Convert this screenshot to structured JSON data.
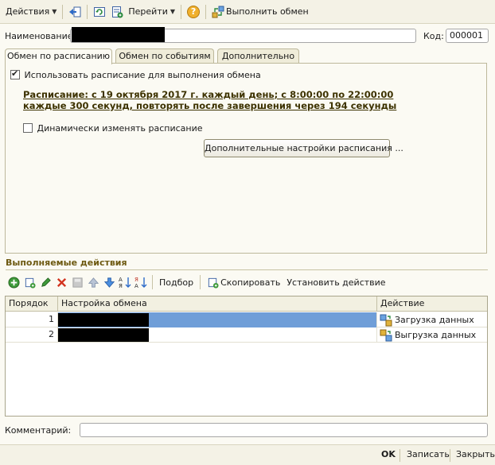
{
  "toolbar": {
    "actions_label": "Действия",
    "goto_label": "Перейти",
    "run_exchange_label": "Выполнить обмен"
  },
  "form": {
    "name_label": "Наименование:",
    "name_value": "",
    "code_label": "Код:",
    "code_value": "000001"
  },
  "tabs": [
    {
      "label": "Обмен по расписанию",
      "active": true
    },
    {
      "label": "Обмен по событиям",
      "active": false
    },
    {
      "label": "Дополнительно",
      "active": false
    }
  ],
  "schedule": {
    "use_schedule_label": "Использовать расписание для выполнения обмена",
    "use_schedule_checked": true,
    "schedule_line1": "Расписание: с 19 октября 2017 г. каждый день; с 8:00:00 по 22:00:00",
    "schedule_line2": "каждые 300 секунд, повторять после завершения через 194 секунды",
    "dynamic_label": "Динамически изменять расписание",
    "dynamic_checked": false,
    "extra_settings_button": "Дополнительные настройки расписания ..."
  },
  "actions_section": {
    "title": "Выполняемые действия",
    "select_label": "Подбор",
    "copy_label": "Скопировать",
    "set_action_label": "Установить действие"
  },
  "grid": {
    "columns": [
      "Порядок",
      "Настройка обмена",
      "Действие"
    ],
    "rows": [
      {
        "order": "1",
        "setting": "",
        "action": "Загрузка данных"
      },
      {
        "order": "2",
        "setting": "",
        "action": "Выгрузка данных"
      }
    ]
  },
  "comment": {
    "label": "Комментарий:",
    "value": ""
  },
  "footer": {
    "ok_label": "OK",
    "save_label": "Записать",
    "close_label": "Закрыть"
  },
  "colors": {
    "background": "#fbfaf3",
    "selection": "#6f9ed8",
    "section_title": "#6e5a12",
    "schedule_link": "#3d3200"
  }
}
